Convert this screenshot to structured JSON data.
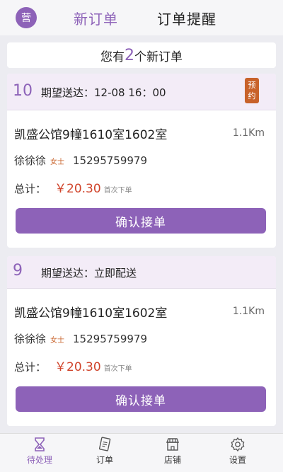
{
  "header": {
    "logo_text": "营",
    "tab_new": "新订单",
    "tab_remind": "订单提醒"
  },
  "summary": {
    "prefix": "您有",
    "count": "2",
    "suffix": "个新订单"
  },
  "orders": [
    {
      "number": "10",
      "deliver_label": "期望送达：",
      "deliver_time": "12-08  16：00",
      "badge_top": "预",
      "badge_bottom": "约",
      "address": "凯盛公馆9幢1610室1602室",
      "distance": "1.1Km",
      "customer_name": "徐徐徐",
      "customer_tag": "女士",
      "phone": "15295759979",
      "total_label": "总计：",
      "amount": "￥20.30",
      "amount_note": "首次下单",
      "confirm_label": "确认接单"
    },
    {
      "number": "9",
      "deliver_label": "期望送达：",
      "deliver_time": "立即配送",
      "address": "凯盛公馆9幢1610室1602室",
      "distance": "1.1Km",
      "customer_name": "徐徐徐",
      "customer_tag": "女士",
      "phone": "15295759979",
      "total_label": "总计：",
      "amount": "￥20.30",
      "amount_note": "首次下单",
      "confirm_label": "确认接单"
    }
  ],
  "bottom_nav": [
    {
      "label": "待处理",
      "icon": "hourglass-icon"
    },
    {
      "label": "订单",
      "icon": "order-list-icon"
    },
    {
      "label": "店铺",
      "icon": "shop-icon"
    },
    {
      "label": "设置",
      "icon": "gear-icon"
    }
  ],
  "colors": {
    "accent": "#8d62b8",
    "price": "#d0442b",
    "badge": "#c8622a"
  }
}
